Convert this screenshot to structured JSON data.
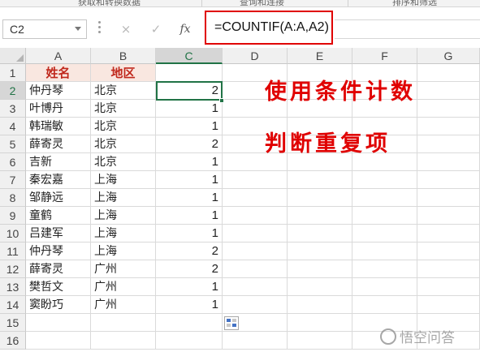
{
  "ribbon": {
    "groups": [
      "获取和转换数据",
      "查询和连接",
      "排序和筛选"
    ]
  },
  "formula_bar": {
    "name_box": "C2",
    "cancel_icon": "×",
    "enter_icon": "✓",
    "fx_label": "fx",
    "formula": "=COUNTIF(A:A,A2)"
  },
  "columns": [
    "A",
    "B",
    "C",
    "D",
    "E",
    "F",
    "G"
  ],
  "active_column": "C",
  "row_numbers": [
    "1",
    "2",
    "3",
    "4",
    "5",
    "6",
    "7",
    "8",
    "9",
    "10",
    "11",
    "12",
    "13",
    "14",
    "15",
    "16"
  ],
  "active_row": "2",
  "header_row": {
    "name": "姓名",
    "region": "地区"
  },
  "rows": [
    {
      "name": "仲丹琴",
      "region": "北京",
      "count": "2"
    },
    {
      "name": "叶博丹",
      "region": "北京",
      "count": "1"
    },
    {
      "name": "韩瑞敏",
      "region": "北京",
      "count": "1"
    },
    {
      "name": "薛寄灵",
      "region": "北京",
      "count": "2"
    },
    {
      "name": "吉新",
      "region": "北京",
      "count": "1"
    },
    {
      "name": "秦宏嘉",
      "region": "上海",
      "count": "1"
    },
    {
      "name": "邹静远",
      "region": "上海",
      "count": "1"
    },
    {
      "name": "童鹤",
      "region": "上海",
      "count": "1"
    },
    {
      "name": "吕建军",
      "region": "上海",
      "count": "1"
    },
    {
      "name": "仲丹琴",
      "region": "上海",
      "count": "2"
    },
    {
      "name": "薛寄灵",
      "region": "广州",
      "count": "2"
    },
    {
      "name": "樊哲文",
      "region": "广州",
      "count": "1"
    },
    {
      "name": "窦盼巧",
      "region": "广州",
      "count": "1"
    }
  ],
  "annotations": [
    "使用条件计数",
    "判断重复项"
  ],
  "watermark": "悟空问答",
  "colors": {
    "accent": "#217346",
    "highlight": "#e00000",
    "header_fill": "#f9e7e0"
  }
}
